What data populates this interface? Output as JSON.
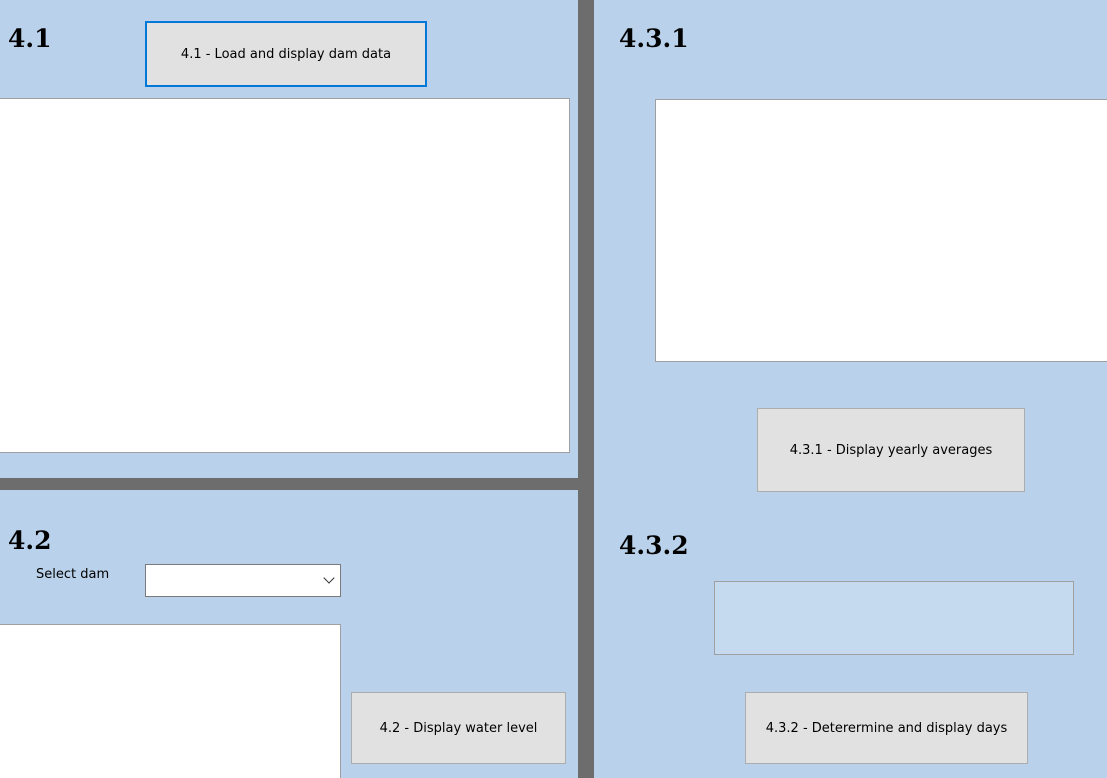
{
  "section_41": {
    "heading": "4.1",
    "button_label": "4.1 - Load and display dam data"
  },
  "section_42": {
    "heading": "4.2",
    "select_label": "Select dam",
    "select_value": "",
    "button_label": "4.2 - Display water level"
  },
  "section_431": {
    "heading": "4.3.1",
    "button_label": "4.3.1 - Display yearly averages"
  },
  "section_432": {
    "heading": "4.3.2",
    "result_value": "",
    "button_label": "4.3.2 - Deterermine and display days"
  },
  "colors": {
    "panel_background": "#b9d1ea",
    "divider": "#6d6d6d",
    "button_face": "#e1e1e1",
    "focus_border": "#0078d7"
  }
}
